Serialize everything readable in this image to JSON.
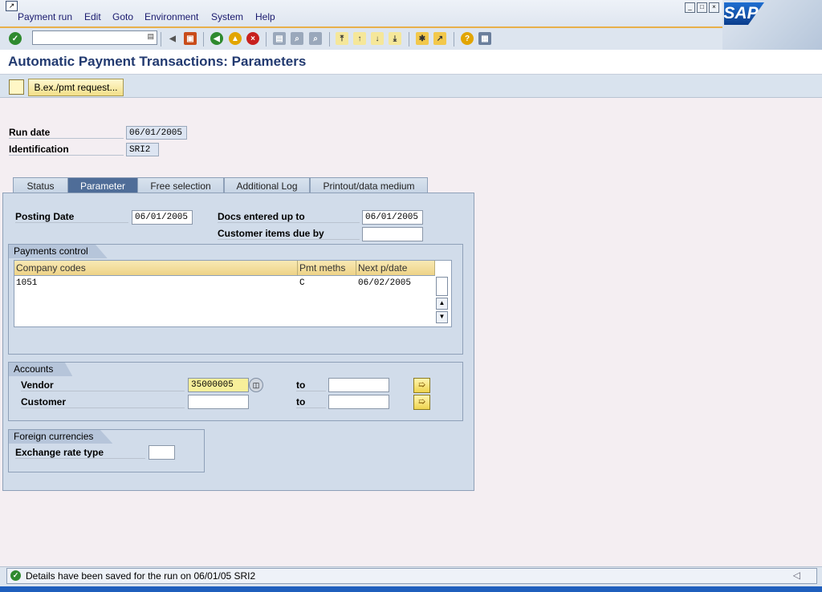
{
  "menu": {
    "items": [
      "Payment run",
      "Edit",
      "Goto",
      "Environment",
      "System",
      "Help"
    ]
  },
  "toolbar": {
    "command_field": "",
    "icons": [
      "enter-icon",
      "save-icon",
      "back-icon",
      "exit-icon",
      "cancel-icon",
      "print-icon",
      "find-icon",
      "find-next-icon",
      "first-page-icon",
      "prev-page-icon",
      "next-page-icon",
      "last-page-icon",
      "create-session-icon",
      "shortcut-icon",
      "help-icon",
      "layout-icon"
    ]
  },
  "brand": {
    "logo_text": "SAP"
  },
  "page": {
    "title": "Automatic Payment Transactions: Parameters"
  },
  "appbar": {
    "bex_label": "B.ex./pmt request..."
  },
  "header_fields": {
    "run_date_label": "Run date",
    "run_date_value": "06/01/2005",
    "identification_label": "Identification",
    "identification_value": "SRI2"
  },
  "tabs": [
    {
      "label": "Status",
      "active": false
    },
    {
      "label": "Parameter",
      "active": true
    },
    {
      "label": "Free selection",
      "active": false
    },
    {
      "label": "Additional Log",
      "active": false
    },
    {
      "label": "Printout/data medium",
      "active": false
    }
  ],
  "parameter": {
    "posting_date_label": "Posting Date",
    "posting_date_value": "06/01/2005",
    "docs_entered_label": "Docs entered up to",
    "docs_entered_value": "06/01/2005",
    "customer_items_label": "Customer items due by",
    "customer_items_value": ""
  },
  "payments_control": {
    "title": "Payments control",
    "columns": [
      "Company codes",
      "Pmt meths",
      "Next p/date"
    ],
    "rows": [
      {
        "company_code": "1051",
        "pmt_meths": "C",
        "next_date": "06/02/2005"
      }
    ]
  },
  "accounts": {
    "title": "Accounts",
    "vendor_label": "Vendor",
    "vendor_from": "35000005",
    "vendor_to_label": "to",
    "vendor_to": "",
    "customer_label": "Customer",
    "customer_from": "",
    "customer_to_label": "to",
    "customer_to": ""
  },
  "foreign_currencies": {
    "title": "Foreign currencies",
    "exchange_rate_type_label": "Exchange rate type",
    "exchange_rate_type_value": ""
  },
  "status": {
    "message": "Details have been saved for the run on 06/01/05 SRI2",
    "icon": "success-check-icon"
  },
  "colors": {
    "title_blue": "#223a70",
    "accent_orange": "#e8b04a",
    "active_tab": "#4f6d98"
  }
}
